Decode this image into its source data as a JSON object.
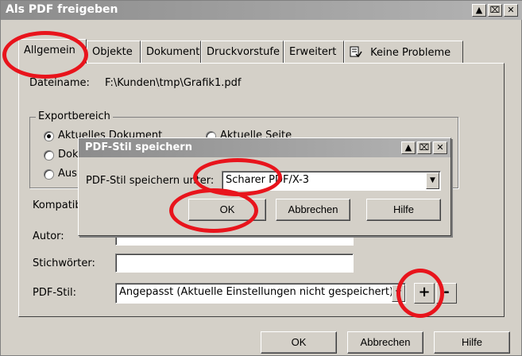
{
  "window": {
    "title": "Als PDF freigeben",
    "controls": [
      "▲",
      "⌧",
      "✕"
    ]
  },
  "tabs": [
    {
      "label": "Allgemein",
      "active": true
    },
    {
      "label": "Objekte",
      "active": false
    },
    {
      "label": "Dokument",
      "active": false
    },
    {
      "label": "Druckvorstufe",
      "active": false
    },
    {
      "label": "Erweitert",
      "active": false
    },
    {
      "label": "Keine Probleme",
      "active": false,
      "icon": "document-check-icon"
    }
  ],
  "general": {
    "filename_label": "Dateiname:",
    "filename_value": "F:\\Kunden\\tmp\\Grafik1.pdf",
    "export_group_label": "Exportbereich",
    "radio_current_doc": "Aktuelles Dokument",
    "radio_current_page": "Aktuelle Seite",
    "radio_documents": "Dok",
    "radio_selection": "Aus",
    "compat_label": "Kompatibilität:",
    "author_label": "Autor:",
    "author_value": "",
    "keywords_label": "Stichwörter:",
    "keywords_value": "",
    "pdf_style_label": "PDF-Stil:",
    "pdf_style_value": "Angepasst (Aktuelle Einstellungen nicht gespeichert)",
    "add_button": "+",
    "remove_button": "-"
  },
  "footer": {
    "ok": "OK",
    "cancel": "Abbrechen",
    "help": "Hilfe"
  },
  "subdialog": {
    "title": "PDF-Stil speichern",
    "save_under_label": "PDF-Stil speichern unter:",
    "save_under_value": "Scharer PDF/X-3",
    "ok": "OK",
    "cancel": "Abbrechen",
    "help": "Hilfe"
  },
  "annotation_color": "#e8141c"
}
